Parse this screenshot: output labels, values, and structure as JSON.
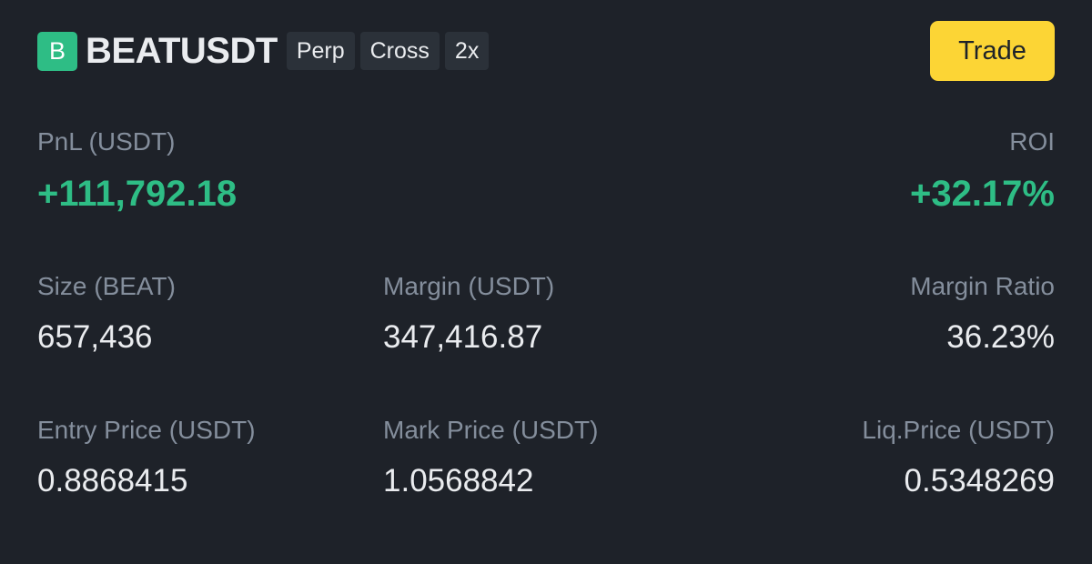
{
  "header": {
    "coin_letter": "B",
    "symbol": "BEATUSDT",
    "tags": [
      "Perp",
      "Cross",
      "2x"
    ],
    "trade_label": "Trade"
  },
  "pnl": {
    "label": "PnL (USDT)",
    "value": "+111,792.18"
  },
  "roi": {
    "label": "ROI",
    "value": "+32.17%"
  },
  "size": {
    "label": "Size (BEAT)",
    "value": "657,436"
  },
  "margin": {
    "label": "Margin (USDT)",
    "value": "347,416.87"
  },
  "margin_ratio": {
    "label": "Margin Ratio",
    "value": "36.23%"
  },
  "entry_price": {
    "label": "Entry Price (USDT)",
    "value": "0.8868415"
  },
  "mark_price": {
    "label": "Mark Price (USDT)",
    "value": "1.0568842"
  },
  "liq_price": {
    "label": "Liq.Price (USDT)",
    "value": "0.5348269"
  },
  "colors": {
    "background": "#1e2229",
    "profit_green": "#2ebd85",
    "trade_yellow": "#fcd535",
    "label_gray": "#848e9c",
    "tag_bg": "#2b3139"
  }
}
